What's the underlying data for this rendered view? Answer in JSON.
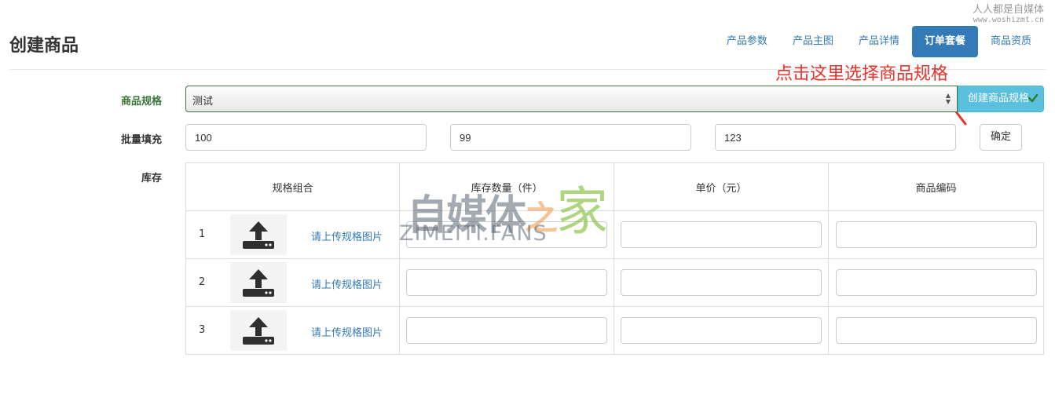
{
  "watermark_top": {
    "line1": "人人都是自媒体",
    "line2": "www.woshizmt.cn"
  },
  "page_title": "创建商品",
  "tabs": [
    {
      "label": "产品参数",
      "active": false
    },
    {
      "label": "产品主图",
      "active": false
    },
    {
      "label": "产品详情",
      "active": false
    },
    {
      "label": "订单套餐",
      "active": true
    },
    {
      "label": "商品资质",
      "active": false
    }
  ],
  "annotation": "点击这里选择商品规格",
  "spec": {
    "label": "商品规格",
    "selected": "测试",
    "create_button": "创建商品规格"
  },
  "batch": {
    "label": "批量填充",
    "values": [
      "100",
      "99",
      "123"
    ],
    "confirm_button": "确定"
  },
  "stock": {
    "label": "库存",
    "headers": [
      "规格组合",
      "库存数量（件）",
      "单价（元）",
      "商品编码"
    ],
    "rows": [
      {
        "num": "1",
        "upload_text": "请上传规格图片"
      },
      {
        "num": "2",
        "upload_text": "请上传规格图片"
      },
      {
        "num": "3",
        "upload_text": "请上传规格图片"
      }
    ]
  },
  "watermark_center": {
    "cn_a": "自媒体",
    "cn_b": "之",
    "cn_c": "家",
    "en": "ZIMEITI.FANS"
  },
  "colors": {
    "primary": "#337ab7",
    "info": "#5bc0de",
    "success": "#3c763d",
    "annotation": "#e8322a"
  },
  "icons": [
    "upload-icon",
    "check-icon",
    "select-arrows-icon"
  ]
}
